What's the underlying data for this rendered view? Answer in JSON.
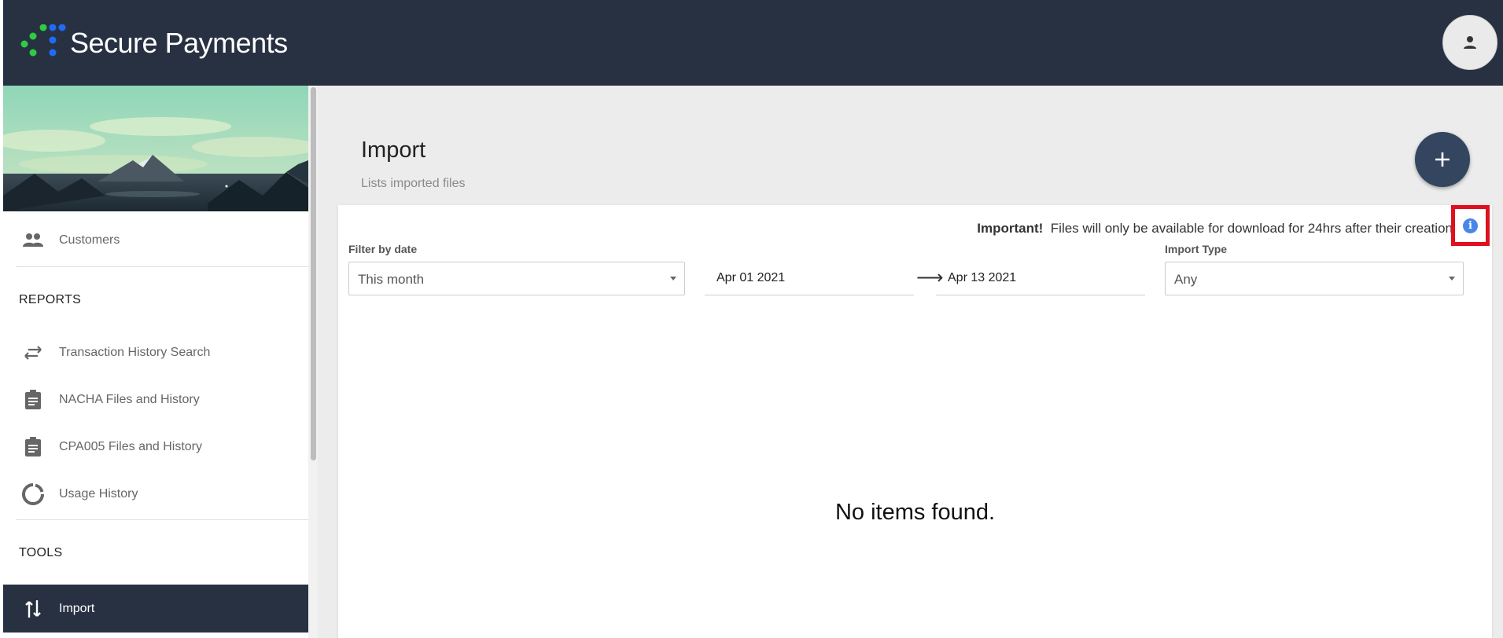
{
  "header": {
    "app_title": "Secure Payments",
    "logo_colors": [
      "#2ecc40",
      "#1e6cf5"
    ],
    "profile_icon": "person-icon"
  },
  "sidebar": {
    "banner": "mountain-landscape-illustration",
    "customers_label": "Customers",
    "reports_heading": "REPORTS",
    "reports_items": [
      {
        "label": "Transaction History Search",
        "icon": "swap-horiz-icon"
      },
      {
        "label": "NACHA Files and History",
        "icon": "clipboard-icon"
      },
      {
        "label": "CPA005 Files and History",
        "icon": "clipboard-icon"
      },
      {
        "label": "Usage History",
        "icon": "donut-icon"
      }
    ],
    "tools_heading": "TOOLS",
    "import_label": "Import",
    "active_color": "#273142"
  },
  "main": {
    "title": "Import",
    "subtitle": "Lists imported files",
    "add_icon": "plus-icon"
  },
  "notice": {
    "bold": "Important!",
    "text": "Files will only be available for download for 24hrs after their creation"
  },
  "filters": {
    "date_label": "Filter by date",
    "date_range_value": "This month",
    "start_date": "Apr 01 2021",
    "arrow": "⟶",
    "end_date": "Apr 13 2021",
    "import_type_label": "Import Type",
    "import_type_value": "Any"
  },
  "empty_state": "No items found."
}
